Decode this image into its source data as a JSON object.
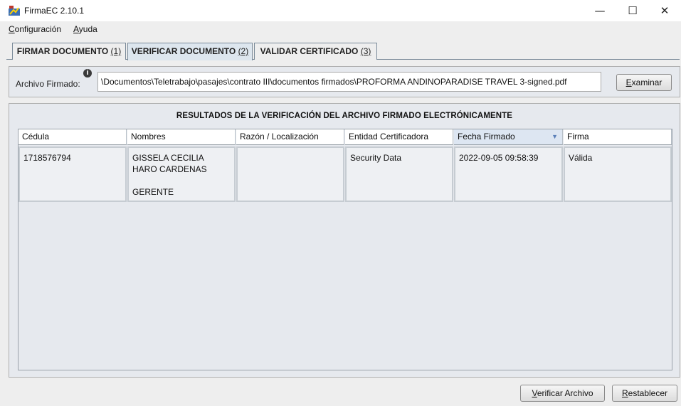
{
  "window": {
    "title": "FirmaEC 2.10.1",
    "minimize": "—",
    "maximize": "☐",
    "close": "✕"
  },
  "menu": {
    "configuracion": {
      "mnemonic": "C",
      "rest": "onfiguración"
    },
    "ayuda": {
      "mnemonic": "A",
      "rest": "yuda"
    }
  },
  "tabs": [
    {
      "label": "FIRMAR DOCUMENTO ",
      "key": "(1)"
    },
    {
      "label": "VERIFICAR DOCUMENTO ",
      "key": "(2)"
    },
    {
      "label": "VALIDAR CERTIFICADO ",
      "key": "(3)"
    }
  ],
  "file": {
    "label": "Archivo Firmado:",
    "value": "\\Documentos\\Teletrabajo\\pasajes\\contrato III\\documentos firmados\\PROFORMA ANDINOPARADISE TRAVEL 3-signed.pdf",
    "browse": {
      "mnemonic": "E",
      "rest": "xaminar"
    }
  },
  "results": {
    "title": "RESULTADOS DE LA VERIFICACIÓN DEL ARCHIVO FIRMADO ELECTRÓNICAMENTE",
    "columns": [
      "Cédula",
      "Nombres",
      "Razón / Localización",
      "Entidad Certificadora",
      "Fecha Firmado",
      "Firma"
    ],
    "sort_indicator": "▼",
    "rows": [
      {
        "cedula": "1718576794",
        "nombres_line1": "GISSELA CECILIA",
        "nombres_line2": "HARO CARDENAS",
        "cargo": "GERENTE",
        "razon": "",
        "entidad": "Security Data",
        "fecha": "2022-09-05 09:58:39",
        "firma": "Válida"
      }
    ]
  },
  "actions": {
    "verificar": {
      "mnemonic": "V",
      "rest": "erificar Archivo"
    },
    "restablecer": {
      "mnemonic": "R",
      "rest": "establecer"
    }
  },
  "colors": {
    "active_tab": "#dde6ee",
    "panel": "#e6e9ee",
    "sorted_header": "#dde6f2"
  }
}
